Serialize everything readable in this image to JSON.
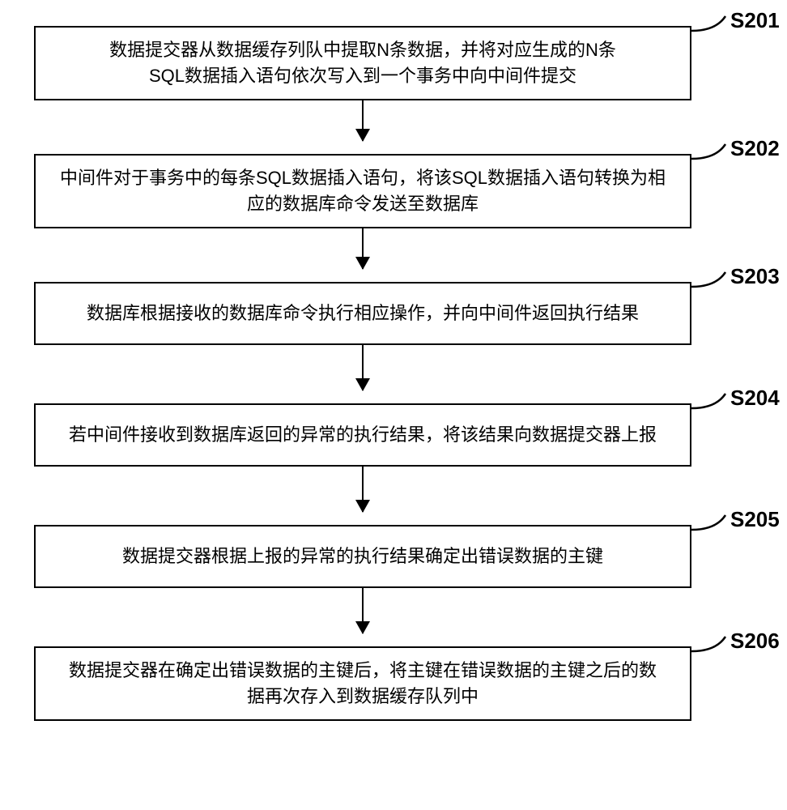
{
  "chart_data": {
    "type": "flowchart",
    "direction": "top-to-bottom",
    "nodes": [
      {
        "id": "S201",
        "label": "数据提交器从数据缓存列队中提取N条数据，并将对应生成的N条SQL数据插入语句依次写入到一个事务中向中间件提交"
      },
      {
        "id": "S202",
        "label": "中间件对于事务中的每条SQL数据插入语句，将该SQL数据插入语句转换为相应的数据库命令发送至数据库"
      },
      {
        "id": "S203",
        "label": "数据库根据接收的数据库命令执行相应操作，并向中间件返回执行结果"
      },
      {
        "id": "S204",
        "label": "若中间件接收到数据库返回的异常的执行结果，将该结果向数据提交器上报"
      },
      {
        "id": "S205",
        "label": "数据提交器根据上报的异常的执行结果确定出错误数据的主键"
      },
      {
        "id": "S206",
        "label": "数据提交器在确定出错误数据的主键后，将主键在错误数据的主键之后的数据再次存入到数据缓存队列中"
      }
    ],
    "edges": [
      {
        "from": "S201",
        "to": "S202"
      },
      {
        "from": "S202",
        "to": "S203"
      },
      {
        "from": "S203",
        "to": "S204"
      },
      {
        "from": "S204",
        "to": "S205"
      },
      {
        "from": "S205",
        "to": "S206"
      }
    ]
  },
  "steps": [
    {
      "id": "S201",
      "text": "数据提交器从数据缓存列队中提取N条数据，并将对应生成的N条\nSQL数据插入语句依次写入到一个事务中向中间件提交"
    },
    {
      "id": "S202",
      "text": "中间件对于事务中的每条SQL数据插入语句，将该SQL数据插入语句转换为相\n应的数据库命令发送至数据库"
    },
    {
      "id": "S203",
      "text": "数据库根据接收的数据库命令执行相应操作，并向中间件返回执行结果"
    },
    {
      "id": "S204",
      "text": "若中间件接收到数据库返回的异常的执行结果，将该结果向数据提交器上报"
    },
    {
      "id": "S205",
      "text": "数据提交器根据上报的异常的执行结果确定出错误数据的主键"
    },
    {
      "id": "S206",
      "text": "数据提交器在确定出错误数据的主键后，将主键在错误数据的主键之后的数\n据再次存入到数据缓存队列中"
    }
  ]
}
